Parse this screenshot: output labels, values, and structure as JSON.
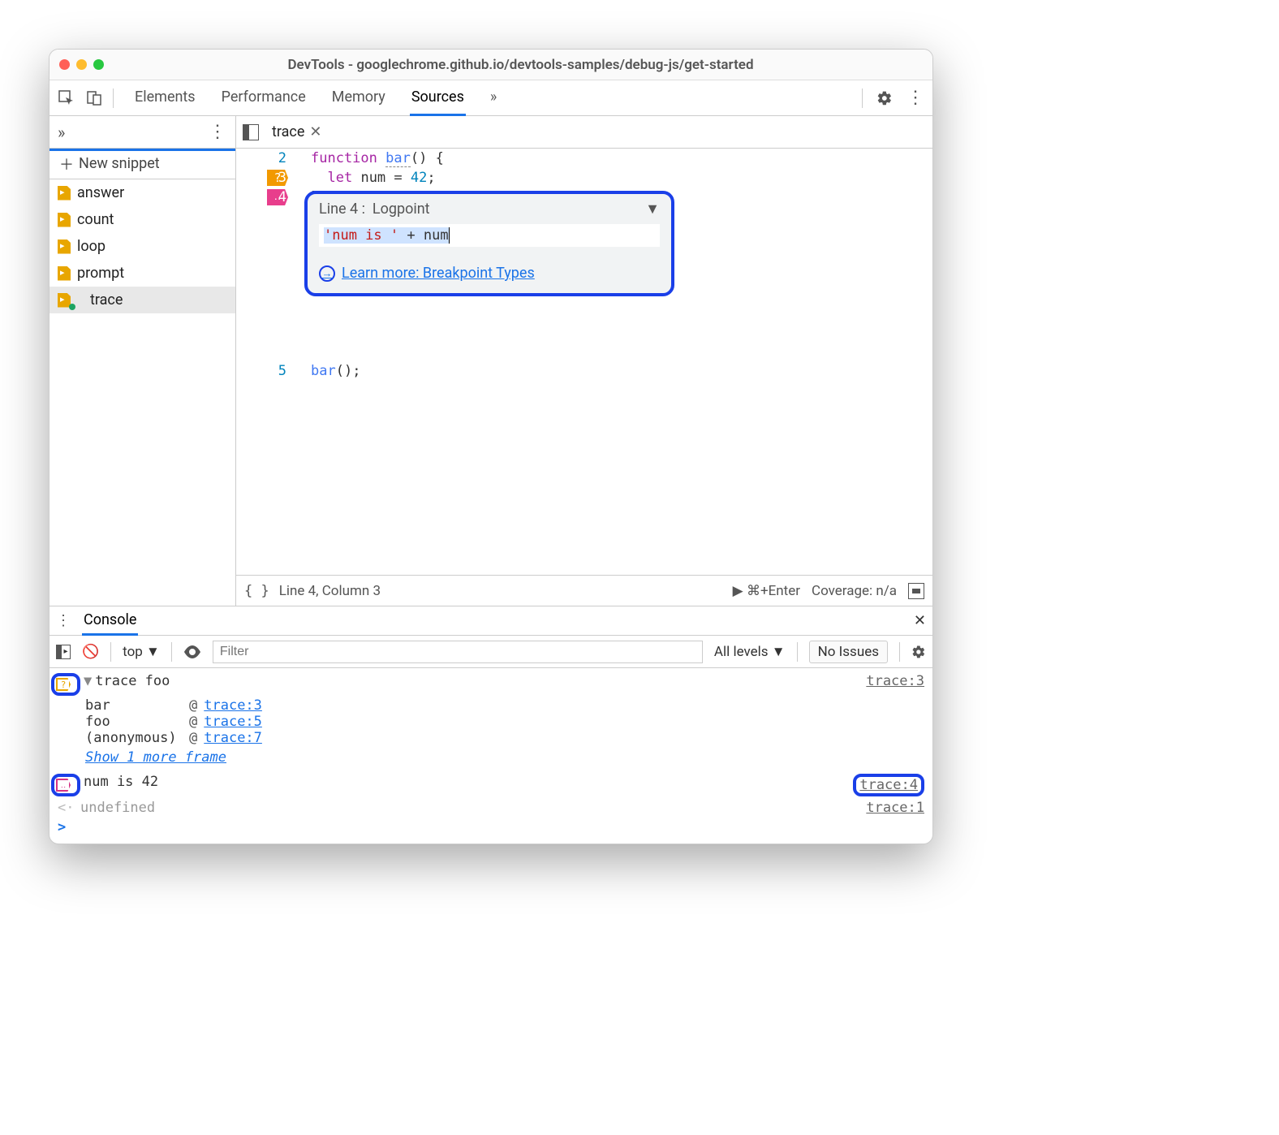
{
  "title": "DevTools - googlechrome.github.io/devtools-samples/debug-js/get-started",
  "main_tabs": {
    "elements": "Elements",
    "performance": "Performance",
    "memory": "Memory",
    "sources": "Sources",
    "overflow": "»"
  },
  "sidebar": {
    "overflow": "»",
    "new_snippet": "New snippet",
    "items": [
      {
        "label": "answer"
      },
      {
        "label": "count"
      },
      {
        "label": "loop"
      },
      {
        "label": "prompt"
      },
      {
        "label": "trace"
      }
    ]
  },
  "editor": {
    "tab_name": "trace",
    "lines": {
      "l2": {
        "num": "2",
        "kw": "function",
        "fn": "bar",
        "rest": "() {"
      },
      "l3": {
        "num": "3",
        "let": "let",
        "var": "num",
        "eq": " = ",
        "val": "42",
        "semi": ";",
        "badge": "?"
      },
      "l4": {
        "num": "4",
        "text": "}",
        "badge": "‥"
      },
      "l5": {
        "num": "5",
        "call": "bar",
        "rest": "();"
      }
    },
    "logpoint": {
      "line_label": "Line 4 :",
      "type": "Logpoint",
      "expr_str": "'num is '",
      "expr_plus": " + ",
      "expr_var": "num",
      "learn_more": "Learn more: Breakpoint Types"
    },
    "status": {
      "braces": "{ }",
      "pos": "Line 4, Column 3",
      "run": "⌘+Enter",
      "coverage": "Coverage: n/a"
    }
  },
  "console": {
    "tab": "Console",
    "context": "top",
    "filter_placeholder": "Filter",
    "levels": "All levels",
    "issues": "No Issues",
    "entries": {
      "trace_msg": "trace foo",
      "trace_src": "trace:3",
      "stack": [
        {
          "fn": "bar",
          "loc": "trace:3"
        },
        {
          "fn": "foo",
          "loc": "trace:5"
        },
        {
          "fn": "(anonymous)",
          "loc": "trace:7"
        }
      ],
      "show_more": "Show 1 more frame",
      "logpoint_msg": "num is 42",
      "logpoint_src": "trace:4",
      "undef": "undefined",
      "undef_src": "trace:1"
    }
  }
}
